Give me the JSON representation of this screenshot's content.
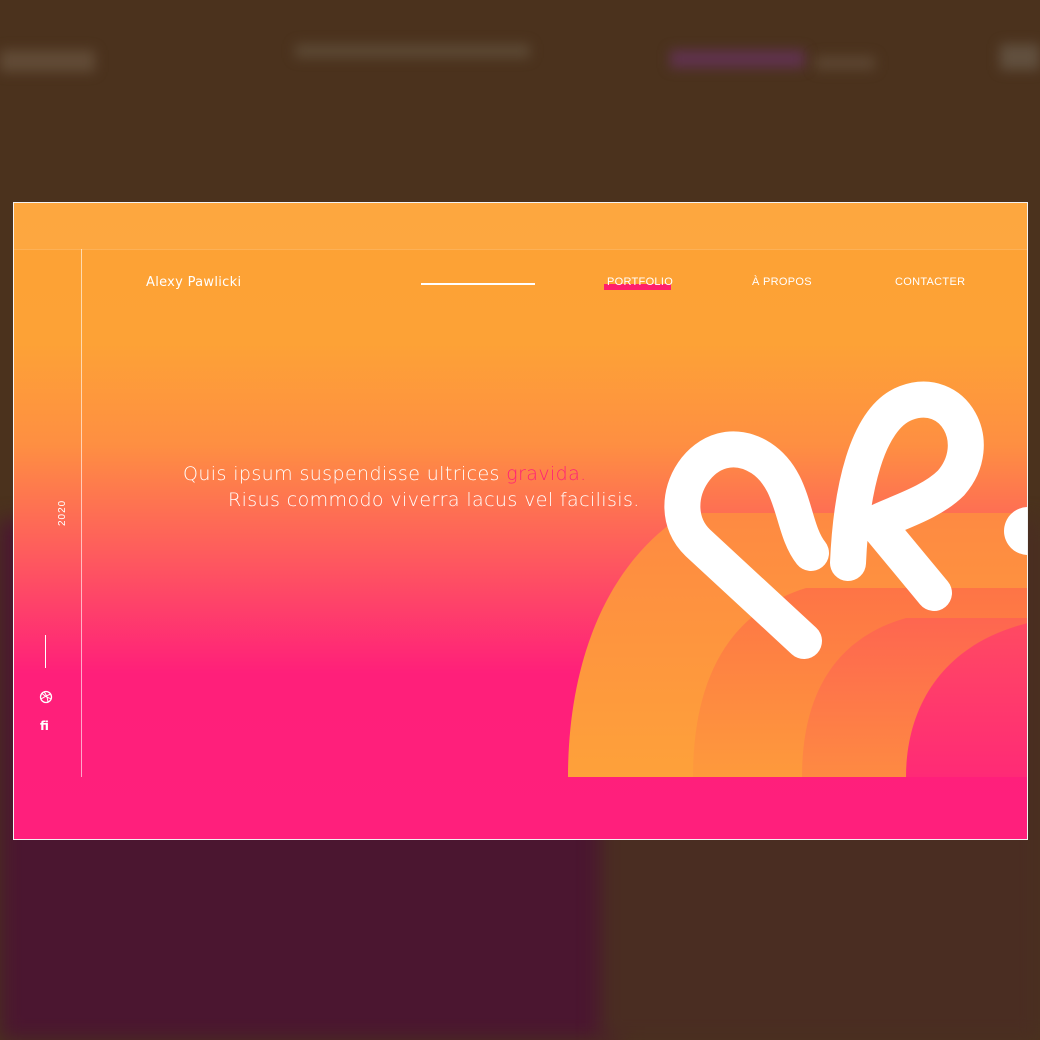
{
  "brand": {
    "name": "Alexy Pawlicki"
  },
  "nav": {
    "items": [
      {
        "label": "PORTFOLIO",
        "active": true
      },
      {
        "label": "À PROPOS",
        "active": false
      },
      {
        "label": "CONTACTER",
        "active": false
      }
    ]
  },
  "sidebar": {
    "year": "2020",
    "social": [
      {
        "icon": "dribbble-icon"
      },
      {
        "icon": "fi-icon",
        "label": "fi"
      }
    ]
  },
  "hero": {
    "line1_prefix": "Quis ipsum suspendisse ultrices ",
    "line1_accent": "gravida.",
    "line2": "Risus commodo viverra lacus vel facilisis."
  },
  "colors": {
    "gradient_top": "#fda234",
    "gradient_bottom": "#ff1f7c",
    "accent": "#ff2077",
    "backdrop": "#4b321d"
  }
}
